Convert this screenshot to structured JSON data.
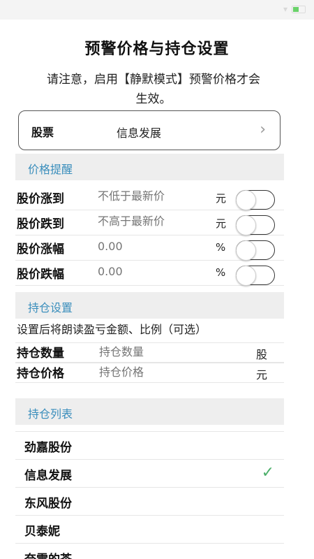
{
  "page": {
    "title": "预警价格与持仓设置",
    "notice": "请注意，启用【静默模式】预警价格才会生效。"
  },
  "stock": {
    "label": "股票",
    "name": "信息发展"
  },
  "price_alert": {
    "section_title": "价格提醒",
    "rows": [
      {
        "label": "股价涨到",
        "placeholder": "不低于最新价",
        "unit": "元",
        "enabled": false
      },
      {
        "label": "股价跌到",
        "placeholder": "不高于最新价",
        "unit": "元",
        "enabled": false
      },
      {
        "label": "股价涨幅",
        "placeholder": "0.00",
        "unit": "%",
        "enabled": false
      },
      {
        "label": "股价跌幅",
        "placeholder": "0.00",
        "unit": "%",
        "enabled": false
      }
    ]
  },
  "holding": {
    "section_title": "持仓设置",
    "hint": "设置后将朗读盈亏金额、比例（可选）",
    "rows": [
      {
        "label": "持仓数量",
        "placeholder": "持仓数量",
        "unit": "股"
      },
      {
        "label": "持仓价格",
        "placeholder": "持仓价格",
        "unit": "元"
      }
    ]
  },
  "holding_list": {
    "section_title": "持仓列表",
    "items": [
      {
        "name": "劲嘉股份",
        "selected": false
      },
      {
        "name": "信息发展",
        "selected": true
      },
      {
        "name": "东风股份",
        "selected": false
      },
      {
        "name": "贝泰妮",
        "selected": false
      },
      {
        "name": "奈雪的茶",
        "selected": false
      }
    ]
  },
  "colors": {
    "accent": "#3a8ebc",
    "check": "#4caf6a",
    "section_bg": "#eeeeee"
  }
}
